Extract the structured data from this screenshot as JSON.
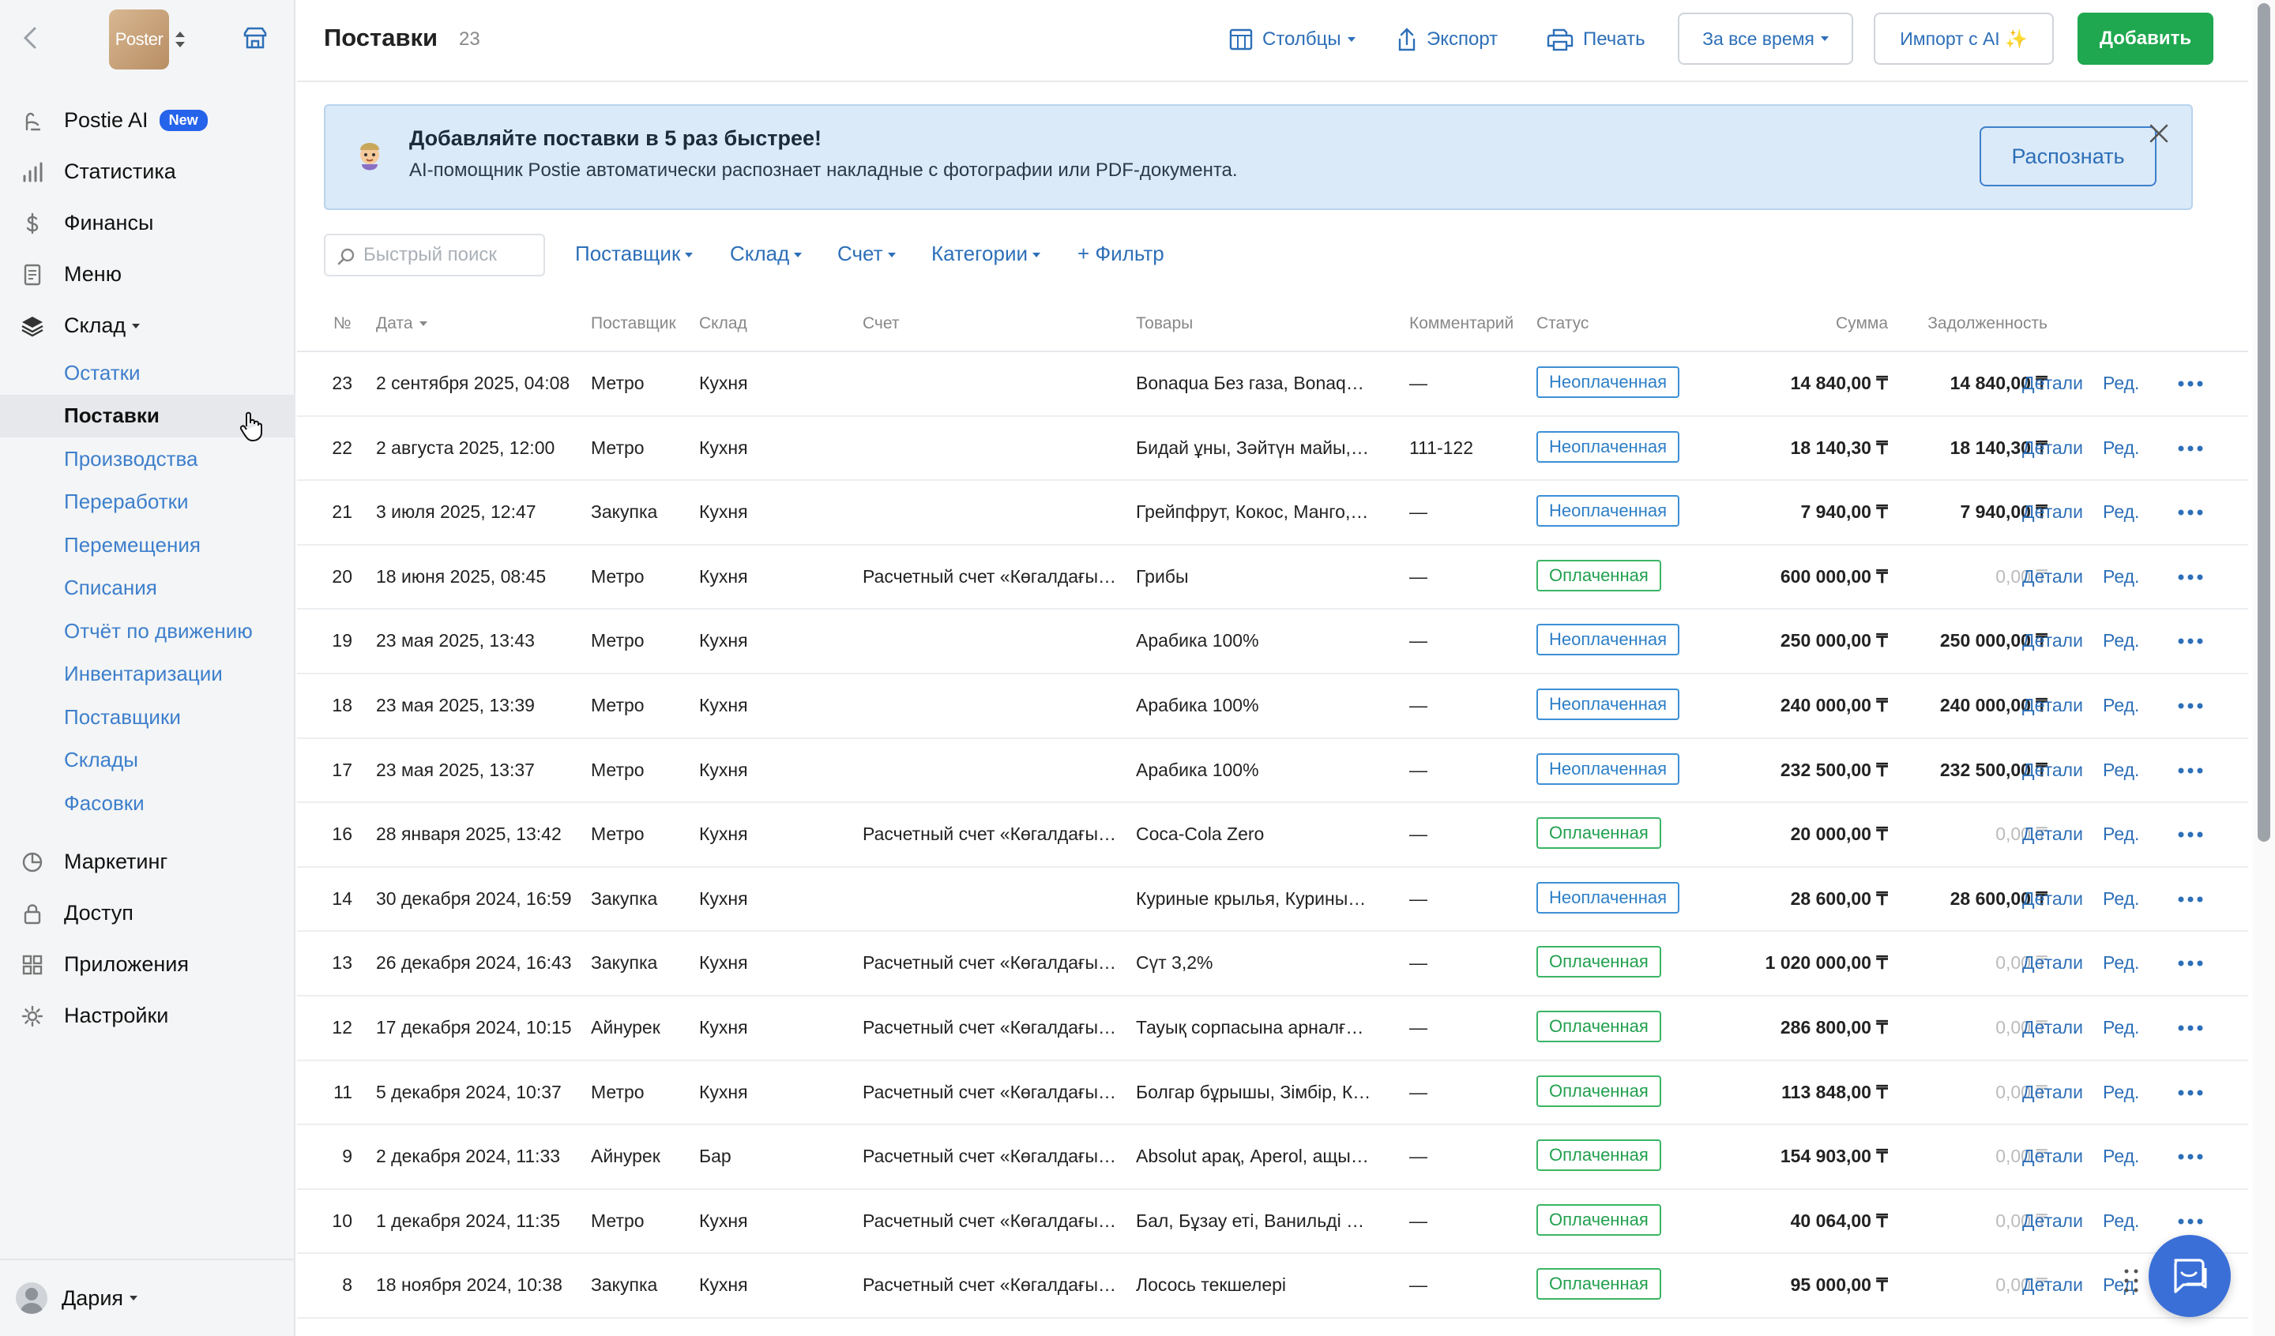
{
  "sidebar": {
    "logo_text": "Poster",
    "nav": [
      {
        "label": "Postie AI",
        "badge": "New"
      },
      {
        "label": "Статистика"
      },
      {
        "label": "Финансы"
      },
      {
        "label": "Меню"
      },
      {
        "label": "Склад"
      }
    ],
    "sub": [
      "Остатки",
      "Поставки",
      "Производства",
      "Переработки",
      "Перемещения",
      "Списания",
      "Отчёт по движению",
      "Инвентаризации",
      "Поставщики",
      "Склады",
      "Фасовки"
    ],
    "nav_bottom": [
      "Маркетинг",
      "Доступ",
      "Приложения",
      "Настройки"
    ],
    "user": "Дария"
  },
  "header": {
    "title": "Поставки",
    "count": "23",
    "columns": "Столбцы",
    "export": "Экспорт",
    "print": "Печать",
    "period": "За все время",
    "import_ai": "Импорт с AI ✨",
    "add": "Добавить"
  },
  "banner": {
    "title": "Добавляйте поставки в 5 раз быстрее!",
    "text": "AI-помощник Postie автоматически распознает накладные с фотографии или PDF-документа.",
    "button": "Распознать"
  },
  "filters": {
    "search_placeholder": "Быстрый поиск",
    "supplier": "Поставщик",
    "warehouse": "Склад",
    "account": "Счет",
    "categories": "Категории",
    "add_filter": "+ Фильтр"
  },
  "table": {
    "headers": {
      "num": "№",
      "date": "Дата",
      "supplier": "Поставщик",
      "warehouse": "Склад",
      "account": "Счет",
      "goods": "Товары",
      "comment": "Комментарий",
      "status": "Статус",
      "sum": "Сумма",
      "debt": "Задолженность"
    },
    "details_label": "Детали",
    "edit_label": "Ред.",
    "rows": [
      {
        "num": "23",
        "date": "2 сентября 2025, 04:08",
        "supplier": "Метро",
        "warehouse": "Кухня",
        "account": "",
        "goods": "Bonaqua Без газа, Bonaqua …",
        "comment": "—",
        "status": "Неоплаченная",
        "paid": false,
        "sum": "14 840,00 ₸",
        "debt": "14 840,00 ₸"
      },
      {
        "num": "22",
        "date": "2 августа 2025, 12:00",
        "supplier": "Метро",
        "warehouse": "Кухня",
        "account": "",
        "goods": "Бидай ұны, Зәйтүн майы, Л…",
        "comment": "111-122",
        "status": "Неоплаченная",
        "paid": false,
        "sum": "18 140,30 ₸",
        "debt": "18 140,30 ₸"
      },
      {
        "num": "21",
        "date": "3 июля 2025, 12:47",
        "supplier": "Закупка",
        "warehouse": "Кухня",
        "account": "",
        "goods": "Грейпфрут, Кокос, Манго, П…",
        "comment": "—",
        "status": "Неоплаченная",
        "paid": false,
        "sum": "7 940,00 ₸",
        "debt": "7 940,00 ₸"
      },
      {
        "num": "20",
        "date": "18 июня 2025, 08:45",
        "supplier": "Метро",
        "warehouse": "Кухня",
        "account": "Расчетный счет «Көгалдағы…",
        "goods": "Грибы",
        "comment": "—",
        "status": "Оплаченная",
        "paid": true,
        "sum": "600 000,00 ₸",
        "debt": "0,00 ₸"
      },
      {
        "num": "19",
        "date": "23 мая 2025, 13:43",
        "supplier": "Метро",
        "warehouse": "Кухня",
        "account": "",
        "goods": "Арабика 100%",
        "comment": "—",
        "status": "Неоплаченная",
        "paid": false,
        "sum": "250 000,00 ₸",
        "debt": "250 000,00 ₸"
      },
      {
        "num": "18",
        "date": "23 мая 2025, 13:39",
        "supplier": "Метро",
        "warehouse": "Кухня",
        "account": "",
        "goods": "Арабика 100%",
        "comment": "—",
        "status": "Неоплаченная",
        "paid": false,
        "sum": "240 000,00 ₸",
        "debt": "240 000,00 ₸"
      },
      {
        "num": "17",
        "date": "23 мая 2025, 13:37",
        "supplier": "Метро",
        "warehouse": "Кухня",
        "account": "",
        "goods": "Арабика 100%",
        "comment": "—",
        "status": "Неоплаченная",
        "paid": false,
        "sum": "232 500,00 ₸",
        "debt": "232 500,00 ₸"
      },
      {
        "num": "16",
        "date": "28 января 2025, 13:42",
        "supplier": "Метро",
        "warehouse": "Кухня",
        "account": "Расчетный счет «Көгалдағы…",
        "goods": "Coca-Cola Zero",
        "comment": "—",
        "status": "Оплаченная",
        "paid": true,
        "sum": "20 000,00 ₸",
        "debt": "0,00 ₸"
      },
      {
        "num": "14",
        "date": "30 декабря 2024, 16:59",
        "supplier": "Закупка",
        "warehouse": "Кухня",
        "account": "",
        "goods": "Куриные крылья, Куриные …",
        "comment": "—",
        "status": "Неоплаченная",
        "paid": false,
        "sum": "28 600,00 ₸",
        "debt": "28 600,00 ₸"
      },
      {
        "num": "13",
        "date": "26 декабря 2024, 16:43",
        "supplier": "Закупка",
        "warehouse": "Кухня",
        "account": "Расчетный счет «Көгалдағы…",
        "goods": "Сүт 3,2%",
        "comment": "—",
        "status": "Оплаченная",
        "paid": true,
        "sum": "1 020 000,00 ₸",
        "debt": "0,00 ₸"
      },
      {
        "num": "12",
        "date": "17 декабря 2024, 10:15",
        "supplier": "Айнурек",
        "warehouse": "Кухня",
        "account": "Расчетный счет «Көгалдағы…",
        "goods": "Тауық сорпасына арналған …",
        "comment": "—",
        "status": "Оплаченная",
        "paid": true,
        "sum": "286 800,00 ₸",
        "debt": "0,00 ₸"
      },
      {
        "num": "11",
        "date": "5 декабря 2024, 10:37",
        "supplier": "Метро",
        "warehouse": "Кухня",
        "account": "Расчетный счет «Көгалдағы…",
        "goods": "Болгар бұрышы, Зімбір, Кок…",
        "comment": "—",
        "status": "Оплаченная",
        "paid": true,
        "sum": "113 848,00 ₸",
        "debt": "0,00 ₸"
      },
      {
        "num": "9",
        "date": "2 декабря 2024, 11:33",
        "supplier": "Айнурек",
        "warehouse": "Бар",
        "account": "Расчетный счет «Көгалдағы…",
        "goods": "Absolut арақ, Aperol, ащы, Р…",
        "comment": "—",
        "status": "Оплаченная",
        "paid": true,
        "sum": "154 903,00 ₸",
        "debt": "0,00 ₸"
      },
      {
        "num": "10",
        "date": "1 декабря 2024, 11:35",
        "supplier": "Метро",
        "warehouse": "Кухня",
        "account": "Расчетный счет «Көгалдағы…",
        "goods": "Бал, Бұзау еті, Ванильді сир…",
        "comment": "—",
        "status": "Оплаченная",
        "paid": true,
        "sum": "40 064,00 ₸",
        "debt": "0,00 ₸"
      },
      {
        "num": "8",
        "date": "18 ноября 2024, 10:38",
        "supplier": "Закупка",
        "warehouse": "Кухня",
        "account": "Расчетный счет «Көгалдағы…",
        "goods": "Лосось текшелері",
        "comment": "—",
        "status": "Оплаченная",
        "paid": true,
        "sum": "95 000,00 ₸",
        "debt": "0,00 ₸"
      }
    ]
  }
}
